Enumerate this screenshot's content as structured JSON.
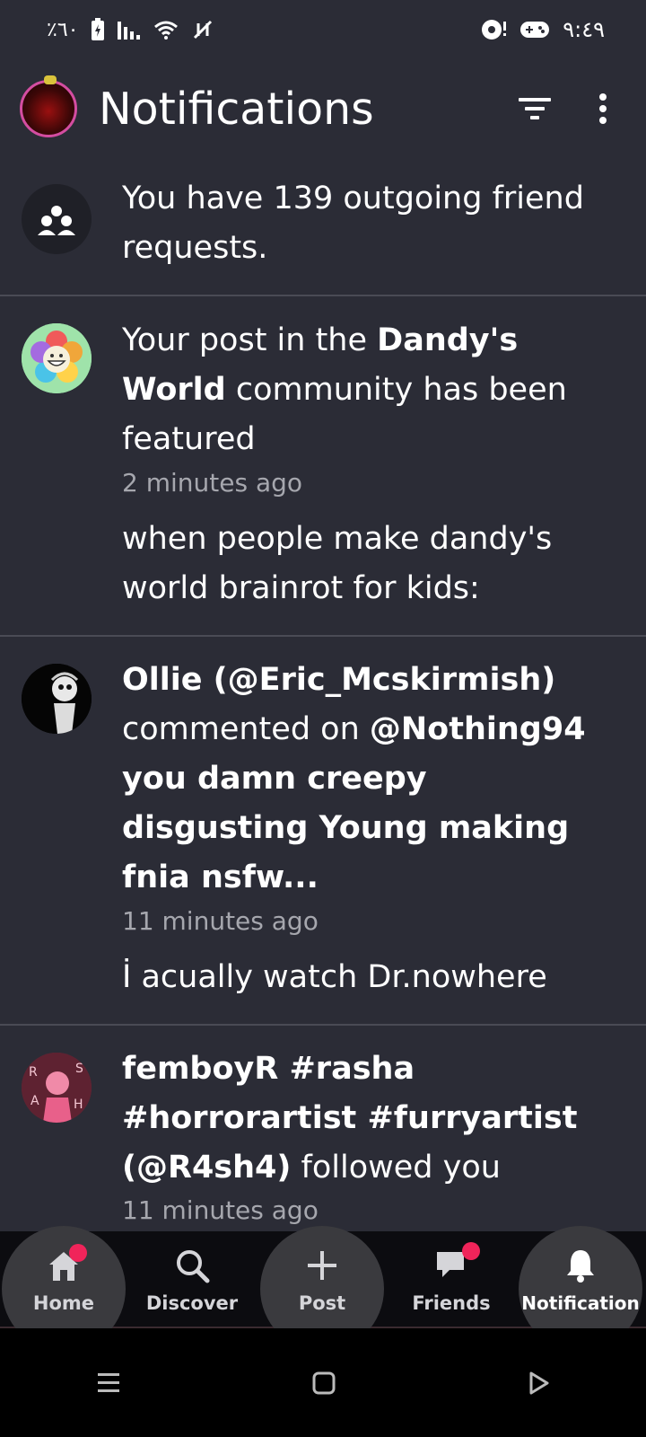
{
  "status_bar": {
    "battery_text": "٪٦٠",
    "time": "٩:٤٩"
  },
  "header": {
    "title": "Notifications"
  },
  "notifications": [
    {
      "avatar": "group-icon",
      "text": "You have 139 outgoing friend requests."
    },
    {
      "avatar": "flower-avatar",
      "text_pre": "Your post in the ",
      "community": "Dandy's World",
      "text_post": " community has been featured",
      "time": "2 minutes ago",
      "preview": "when people make dandy's world brainrot for kids:"
    },
    {
      "avatar": "user-avatar",
      "user": "Ollie (@Eric_Mcskirmish)",
      "action": " commented on ",
      "target": "@Nothing94 you damn creepy disgusting Young making fnia nsfw...",
      "time": "11 minutes ago",
      "preview": "İ acually watch Dr.nowhere"
    },
    {
      "avatar": "user-avatar",
      "user": "femboyR #rasha #horrorartist #furryartist (@R4sh4)",
      "action": " followed you",
      "time": "11 minutes ago"
    }
  ],
  "bottom_nav": [
    {
      "label": "Home",
      "icon": "home-icon",
      "badge": true
    },
    {
      "label": "Discover",
      "icon": "search-icon",
      "badge": false
    },
    {
      "label": "Post",
      "icon": "plus-icon",
      "badge": false
    },
    {
      "label": "Friends",
      "icon": "chat-icon",
      "badge": true
    },
    {
      "label": "Notification",
      "icon": "bell-icon",
      "badge": false,
      "active": true
    }
  ],
  "colors": {
    "background": "#2b2c36",
    "badge": "#f0245a",
    "nav_bg": "#0c0c10"
  }
}
